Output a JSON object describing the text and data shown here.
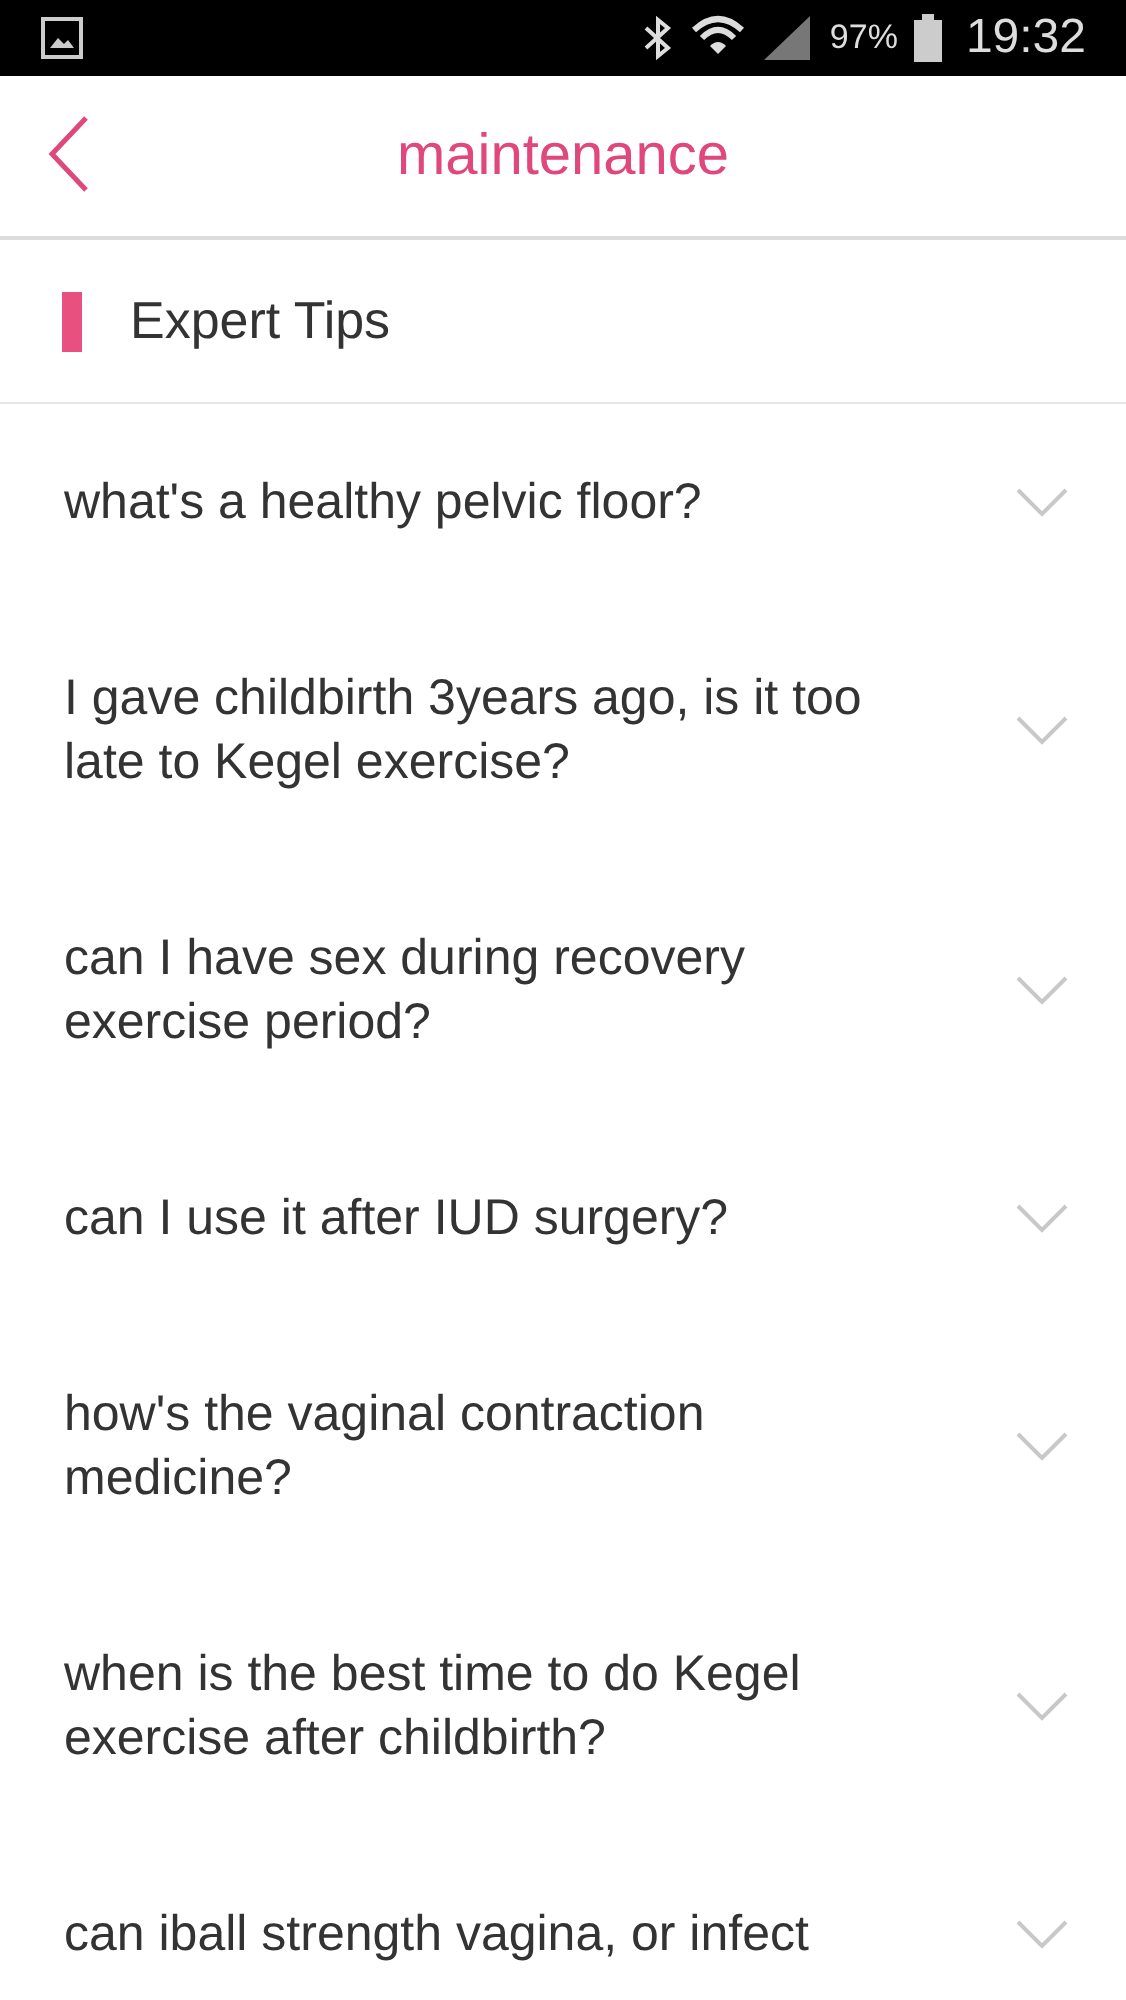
{
  "status_bar": {
    "battery": "97%",
    "time": "19:32"
  },
  "header": {
    "title": "maintenance"
  },
  "section": {
    "title": "Expert Tips"
  },
  "questions": [
    {
      "text": "what's a healthy pelvic floor?",
      "expanded": false
    },
    {
      "text": "I gave childbirth 3years ago, is it too late to Kegel exercise?",
      "expanded": false
    },
    {
      "text": "can I have sex during recovery exercise period?",
      "expanded": false
    },
    {
      "text": "can I use it after IUD surgery?",
      "expanded": false
    },
    {
      "text": "how's the vaginal contraction medicine?",
      "expanded": false
    },
    {
      "text": "when is the best time to do Kegel exercise after childbirth?",
      "expanded": false
    },
    {
      "text": "can iball strength vagina, or infect",
      "expanded": false
    }
  ]
}
